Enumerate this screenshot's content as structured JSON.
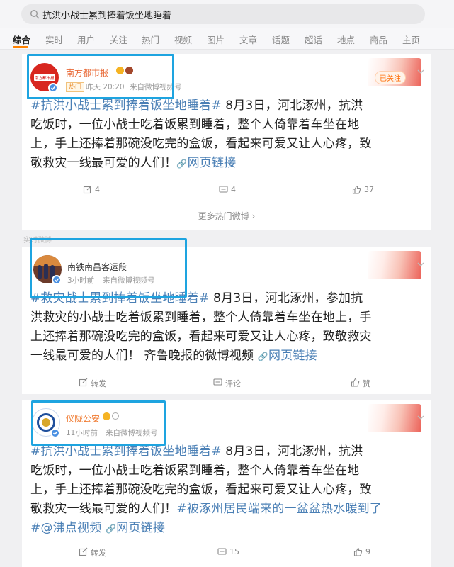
{
  "search": {
    "query": "抗洪小战士累到捧着饭坐地睡着"
  },
  "tabs": [
    "综合",
    "实时",
    "用户",
    "关注",
    "热门",
    "视频",
    "图片",
    "文章",
    "话题",
    "超话",
    "地点",
    "商品",
    "主页"
  ],
  "posts": [
    {
      "author": "南方都市报",
      "avatar_text": "南方都市报",
      "tag_label": "热门",
      "time": "昨天 20:20",
      "source": "来自微博视频号",
      "follow_label": "已关注",
      "hashtag": "#抗洪小战士累到捧着饭坐地睡着#",
      "text_lines": [
        " 8月3日，河北涿州，抗洪",
        "吃饭时，一位小战士吃着饭累到睡着，整个人倚靠着车坐在地",
        "上，手上还捧着那碗没吃完的盒饭，看起来可爱又让人心疼，致",
        "敬救灾一线最可爱的人们！"
      ],
      "link": "网页链接",
      "reposts": "4",
      "comments": "4",
      "likes": "37",
      "more_hot": "更多热门微博"
    },
    {
      "faded_label": "实时微博",
      "author": "南铁南昌客运段",
      "time": "3小时前",
      "source": "来自微博视频号",
      "hashtag": "#救灾战士累到捧着饭坐地睡着#",
      "text_lines": [
        " 8月3日，河北涿州，参加抗",
        "洪救灾的小战士吃着饭累到睡着，整个人倚靠着车坐在地上，手",
        "上还捧着那碗没吃完的盒饭，看起来可爱又让人心疼，致敬救灾",
        "一线最可爱的人们！ 齐鲁晚报的微博视频 "
      ],
      "link": "网页链接",
      "reposts": "转发",
      "comments": "评论",
      "likes": "赞"
    },
    {
      "author": "仪陇公安",
      "time": "11小时前",
      "source": "来自微博视频号",
      "hashtag": "#抗洪小战士累到捧着饭坐地睡着#",
      "text_lines": [
        " 8月3日，河北涿州，抗洪",
        "吃饭时，一位小战士吃着饭累到睡着，整个人倚靠着车坐在地",
        "上，手上还捧着那碗没吃完的盒饭，看起来可爱又让人心疼，致",
        "敬救灾一线最可爱的人们！"
      ],
      "hashtag2": "#被涿州居民端来的一盆盆热水暖到了",
      "hashtag3": "#@沸点视频",
      "link": "网页链接",
      "reposts": "转发",
      "comments": "15",
      "likes": "9"
    }
  ],
  "colors": {
    "accent": "#ff8200",
    "link": "#4a7fb5",
    "highlight_box": "#1ea4e0",
    "name": "#e96c3a"
  }
}
